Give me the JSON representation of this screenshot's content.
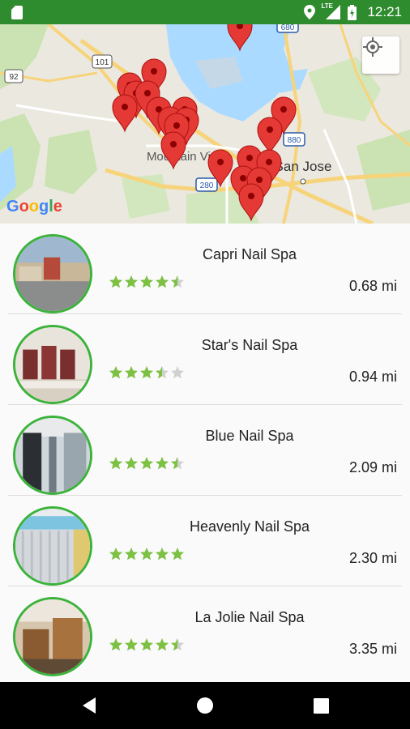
{
  "status_bar": {
    "time": "12:21",
    "network_label": "LTE",
    "icons": [
      "sd-card-icon",
      "location-icon",
      "lte-signal-icon",
      "battery-icon"
    ],
    "background_color": "#2e8b2e"
  },
  "map": {
    "provider_logo": "Google",
    "city_labels": [
      "Mountain View",
      "San Jose"
    ],
    "highway_labels": [
      "101",
      "92",
      "280",
      "680",
      "880"
    ],
    "marker_color": "#e53935",
    "locate_button": "my-location-icon"
  },
  "places": [
    {
      "name": "Capri Nail Spa",
      "rating": 4.5,
      "distance": "0.68 mi"
    },
    {
      "name": "Star's Nail Spa",
      "rating": 3.5,
      "distance": "0.94 mi"
    },
    {
      "name": "Blue Nail Spa",
      "rating": 4.5,
      "distance": "2.09 mi"
    },
    {
      "name": "Heavenly Nail Spa",
      "rating": 5,
      "distance": "2.30 mi"
    },
    {
      "name": "La Jolie Nail Spa",
      "rating": 4.5,
      "distance": "3.35 mi"
    }
  ],
  "colors": {
    "accent": "#3bb33b",
    "star_filled": "#7cc142",
    "star_empty": "#d0d0d0"
  },
  "nav_bar": {
    "buttons": [
      "back-icon",
      "home-icon",
      "recents-icon"
    ]
  }
}
